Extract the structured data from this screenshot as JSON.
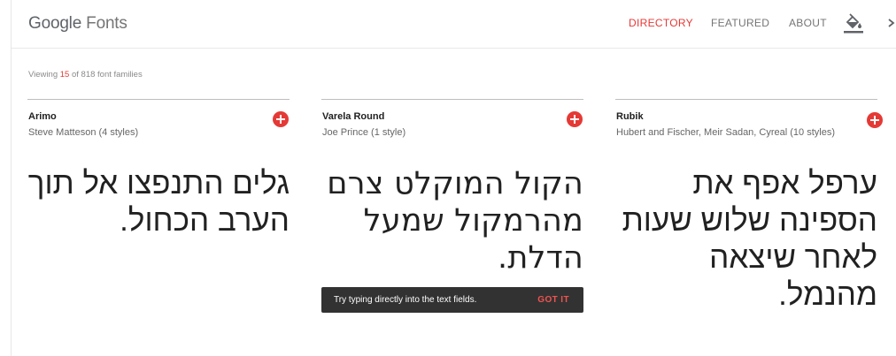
{
  "header": {
    "logo_google": "Google",
    "logo_fonts": "Fonts",
    "nav": {
      "directory": "DIRECTORY",
      "featured": "FEATURED",
      "about": "ABOUT"
    },
    "active_nav": "directory",
    "icons": {
      "paint": "format-color-fill-icon",
      "more": "chevron-right-icon"
    }
  },
  "summary": {
    "prefix": "Viewing ",
    "shown": "15",
    "suffix": " of 818 font families"
  },
  "cards": [
    {
      "family": "Arimo",
      "meta": "Steve Matteson (4 styles)",
      "sample": "גלים התנפצו אל תוך הערב הכחול."
    },
    {
      "family": "Varela Round",
      "meta": "Joe Prince (1 style)",
      "sample": "הקול המוקלט צרם מהרמקול שמעל הדלת."
    },
    {
      "family": "Rubik",
      "meta": "Hubert and Fischer, Meir Sadan, Cyreal (10 styles)",
      "sample": "ערפל אפף את הספינה שלוש שעות לאחר שיצאה מהנמל."
    }
  ],
  "toast": {
    "message": "Try typing directly into the text fields.",
    "action": "GOT IT"
  },
  "colors": {
    "accent": "#e53935",
    "toast_bg": "#323232",
    "divider": "#bdbdbd"
  }
}
